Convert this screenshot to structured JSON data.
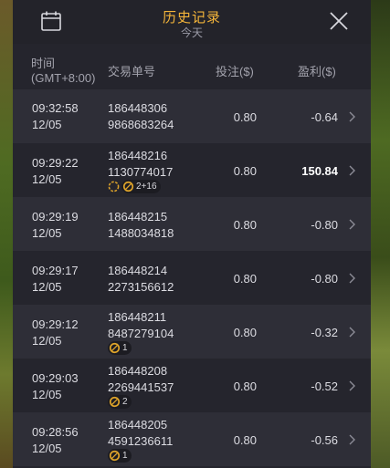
{
  "header": {
    "title": "历史记录",
    "subtitle": "今天"
  },
  "columns": {
    "time_line1": "时间",
    "time_line2": "(GMT+8:00)",
    "order": "交易单号",
    "bet": "投注($)",
    "profit": "盈利($)"
  },
  "rows": [
    {
      "time": "09:32:58",
      "date": "12/05",
      "order1": "186448306",
      "order2": "9868683264",
      "bet": "0.80",
      "profit": "-0.64"
    },
    {
      "time": "09:29:22",
      "date": "12/05",
      "order1": "186448216",
      "order2": "1130774017",
      "bet": "0.80",
      "profit": "150.84",
      "badge_count": "2+16"
    },
    {
      "time": "09:29:19",
      "date": "12/05",
      "order1": "186448215",
      "order2": "1488034818",
      "bet": "0.80",
      "profit": "-0.80"
    },
    {
      "time": "09:29:17",
      "date": "12/05",
      "order1": "186448214",
      "order2": "2273156612",
      "bet": "0.80",
      "profit": "-0.80"
    },
    {
      "time": "09:29:12",
      "date": "12/05",
      "order1": "186448211",
      "order2": "8487279104",
      "bet": "0.80",
      "profit": "-0.32",
      "badge_count": "1"
    },
    {
      "time": "09:29:03",
      "date": "12/05",
      "order1": "186448208",
      "order2": "2269441537",
      "bet": "0.80",
      "profit": "-0.52",
      "badge_count": "2"
    },
    {
      "time": "09:28:56",
      "date": "12/05",
      "order1": "186448205",
      "order2": "4591236611",
      "bet": "0.80",
      "profit": "-0.56",
      "badge_count": "1"
    }
  ],
  "icons": {
    "calendar": "calendar-icon",
    "close": "close-icon",
    "chevron": "chevron-right-icon",
    "free_spin": "free-spin-icon",
    "bonus_coin": "bonus-coin-icon"
  },
  "colors": {
    "accent": "#f3b43a",
    "panel_bg": "#25252d",
    "row_alt_bg": "#2e2e37"
  }
}
